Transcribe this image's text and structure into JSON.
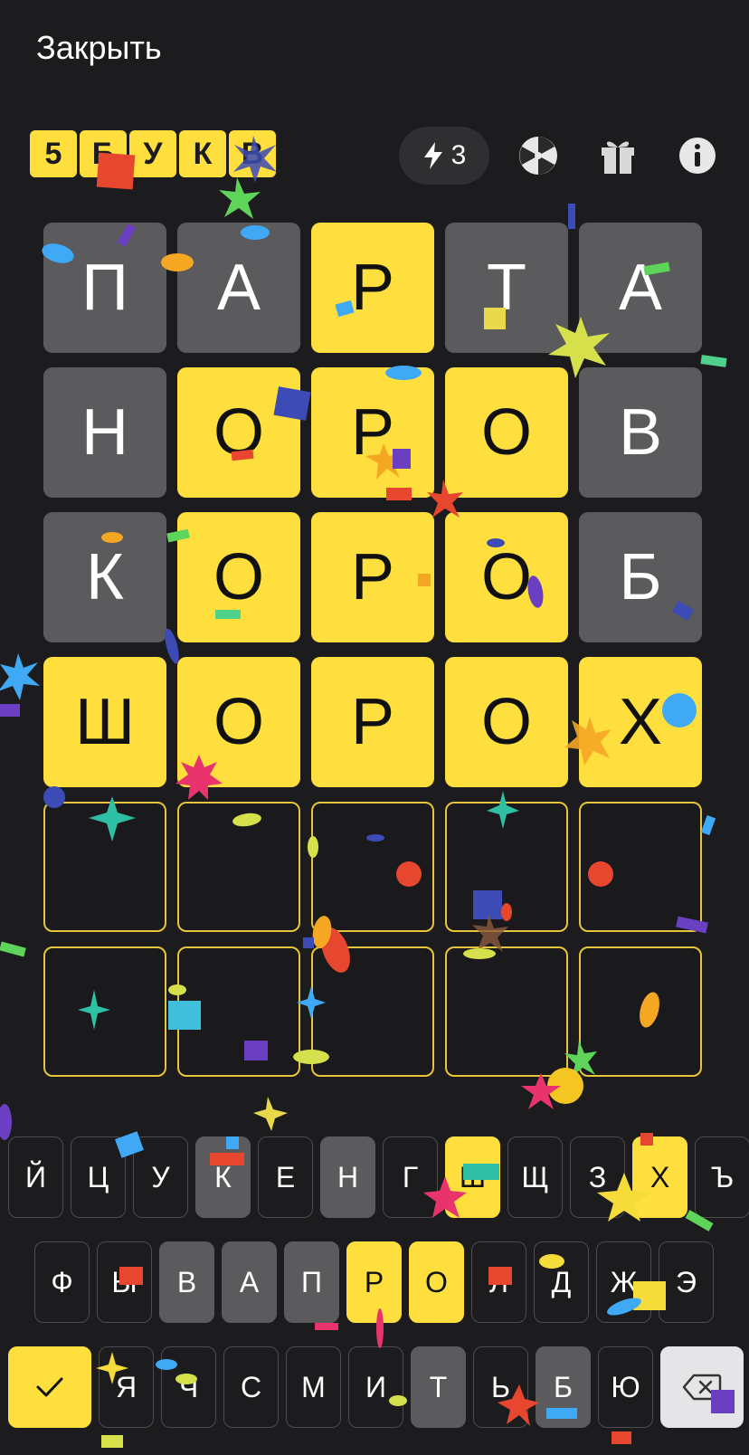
{
  "header": {
    "close_label": "Закрыть",
    "hints_count": "3"
  },
  "logo": {
    "letters": [
      "5",
      "Б",
      "У",
      "К",
      "В"
    ]
  },
  "icons": {
    "hints": "lightning-icon",
    "wheel": "wheel-icon",
    "gift": "gift-icon",
    "info": "info-icon"
  },
  "colors": {
    "background": "#1c1c1e",
    "absent": "#5b5b5e",
    "present": "#ffdf3e",
    "empty_border": "#e6c53a"
  },
  "board": {
    "rows": [
      {
        "letters": [
          "П",
          "А",
          "Р",
          "Т",
          "А"
        ],
        "states": [
          "absent",
          "absent",
          "present",
          "absent",
          "absent"
        ]
      },
      {
        "letters": [
          "Н",
          "О",
          "Р",
          "О",
          "В"
        ],
        "states": [
          "absent",
          "present",
          "present",
          "present",
          "absent"
        ]
      },
      {
        "letters": [
          "К",
          "О",
          "Р",
          "О",
          "Б"
        ],
        "states": [
          "absent",
          "present",
          "present",
          "present",
          "absent"
        ]
      },
      {
        "letters": [
          "Ш",
          "О",
          "Р",
          "О",
          "Х"
        ],
        "states": [
          "present",
          "present",
          "present",
          "present",
          "present"
        ]
      },
      {
        "letters": [
          "",
          "",
          "",
          "",
          ""
        ],
        "states": [
          "empty",
          "empty",
          "empty",
          "empty",
          "empty"
        ]
      },
      {
        "letters": [
          "",
          "",
          "",
          "",
          ""
        ],
        "states": [
          "empty",
          "empty",
          "empty",
          "empty",
          "empty"
        ]
      }
    ]
  },
  "keyboard": {
    "row1": [
      {
        "label": "Й",
        "state": "unused"
      },
      {
        "label": "Ц",
        "state": "unused"
      },
      {
        "label": "У",
        "state": "unused"
      },
      {
        "label": "К",
        "state": "absent"
      },
      {
        "label": "Е",
        "state": "unused"
      },
      {
        "label": "Н",
        "state": "absent"
      },
      {
        "label": "Г",
        "state": "unused"
      },
      {
        "label": "Ш",
        "state": "present"
      },
      {
        "label": "Щ",
        "state": "unused"
      },
      {
        "label": "З",
        "state": "unused"
      },
      {
        "label": "Х",
        "state": "present"
      },
      {
        "label": "Ъ",
        "state": "unused"
      }
    ],
    "row2": [
      {
        "label": "Ф",
        "state": "unused"
      },
      {
        "label": "Ы",
        "state": "unused"
      },
      {
        "label": "В",
        "state": "absent"
      },
      {
        "label": "А",
        "state": "absent"
      },
      {
        "label": "П",
        "state": "absent"
      },
      {
        "label": "Р",
        "state": "present"
      },
      {
        "label": "О",
        "state": "present"
      },
      {
        "label": "Л",
        "state": "unused"
      },
      {
        "label": "Д",
        "state": "unused"
      },
      {
        "label": "Ж",
        "state": "unused"
      },
      {
        "label": "Э",
        "state": "unused"
      }
    ],
    "row3": [
      {
        "label": "Я",
        "state": "unused"
      },
      {
        "label": "Ч",
        "state": "unused"
      },
      {
        "label": "С",
        "state": "unused"
      },
      {
        "label": "М",
        "state": "unused"
      },
      {
        "label": "И",
        "state": "unused"
      },
      {
        "label": "Т",
        "state": "absent"
      },
      {
        "label": "Ь",
        "state": "unused"
      },
      {
        "label": "Б",
        "state": "absent"
      },
      {
        "label": "Ю",
        "state": "unused"
      }
    ],
    "enter_icon": "checkmark-icon",
    "delete_icon": "backspace-icon"
  }
}
